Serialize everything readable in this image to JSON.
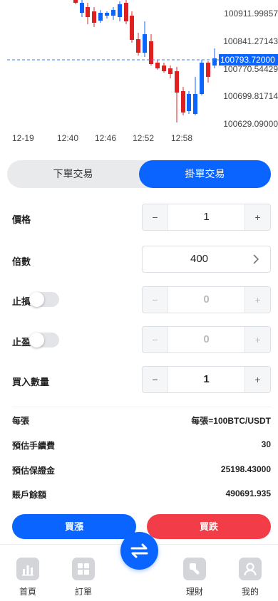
{
  "chart": {
    "price_labels": [
      "100911.99857",
      "100841.27143",
      "100770.54429",
      "100699.81714",
      "100629.09000"
    ],
    "current_price": "100793.72000",
    "time_labels": [
      "12-19",
      "12:40",
      "12:46",
      "12:52",
      "12:58"
    ],
    "up_color": "#0a64ff",
    "down_color": "#e02020"
  },
  "tabs": {
    "left": "下單交易",
    "right": "掛單交易",
    "active": "right"
  },
  "form": {
    "price": {
      "label": "價格",
      "value": "1",
      "minus": "−",
      "plus": "+"
    },
    "leverage": {
      "label": "倍數",
      "value": "400"
    },
    "stop_loss": {
      "label": "止損",
      "value": "0",
      "minus": "−",
      "plus": "+",
      "enabled": false
    },
    "take_profit": {
      "label": "止盈",
      "value": "0",
      "minus": "−",
      "plus": "+",
      "enabled": false
    },
    "quantity": {
      "label": "買入數量",
      "value": "1",
      "minus": "−",
      "plus": "+"
    }
  },
  "info": {
    "per_lot": {
      "label": "每張",
      "value": "每張=100BTC/USDT"
    },
    "fee": {
      "label": "預估手續費",
      "value": "30"
    },
    "margin": {
      "label": "預估保證金",
      "value": "25198.43000"
    },
    "balance": {
      "label": "賬戶餘額",
      "value": "490691.935"
    }
  },
  "actions": {
    "buy": "買漲",
    "sell": "買跌"
  },
  "nav": {
    "items": [
      {
        "label": "首頁",
        "icon": "chart-icon"
      },
      {
        "label": "訂單",
        "icon": "grid-icon"
      },
      {
        "label": "理財",
        "icon": "wallet-icon"
      },
      {
        "label": "我的",
        "icon": "user-icon"
      }
    ],
    "center_icon": "swap-icon"
  }
}
